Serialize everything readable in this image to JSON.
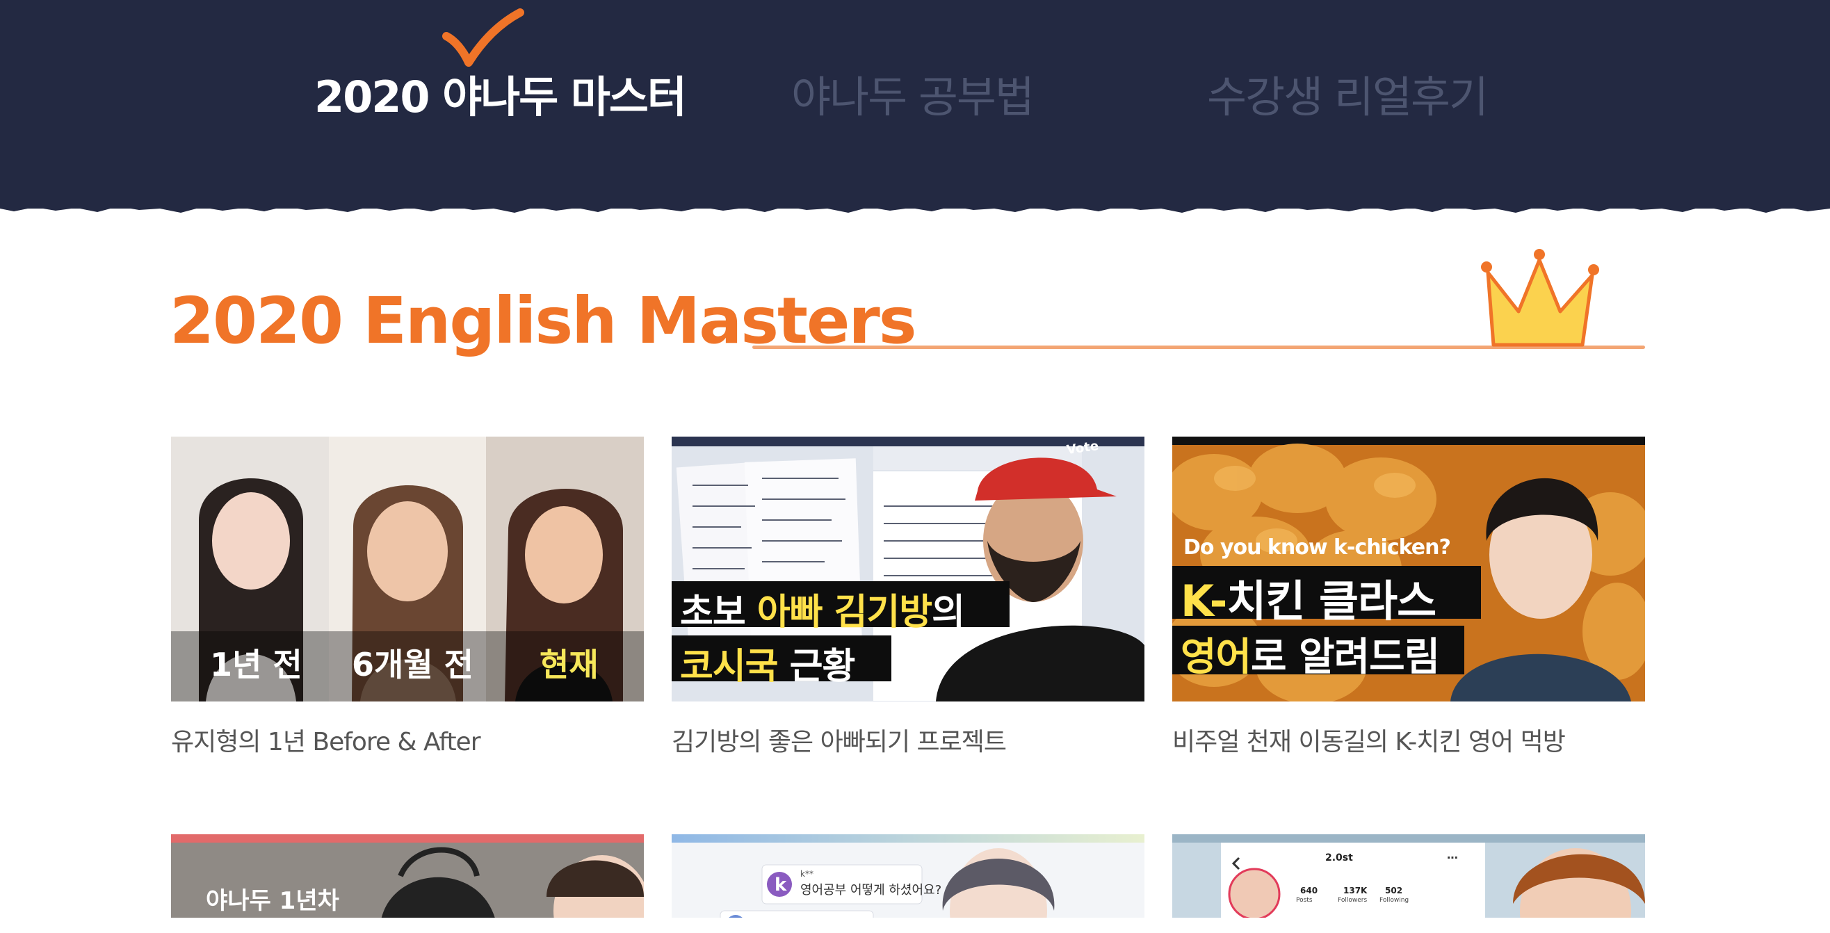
{
  "nav": {
    "items": [
      {
        "label": "2020 야나두 마스터",
        "active": true
      },
      {
        "label": "야나두 공부법",
        "active": false
      },
      {
        "label": "수강생 리얼후기",
        "active": false
      }
    ]
  },
  "section": {
    "title": "2020 English Masters"
  },
  "cards": [
    {
      "title": "유지형의 1년 Before & After",
      "thumb": {
        "captions": [
          "1년 전",
          "6개월 전",
          "현재"
        ]
      }
    },
    {
      "title": "김기방의 좋은 아빠되기 프로젝트",
      "thumb": {
        "line1_white": "초보 ",
        "line1_yellow": "아빠 김기방",
        "line1_white2": "의",
        "line2_yellow": "코시국 ",
        "line2_white": "근황",
        "cap_text": "Vote"
      }
    },
    {
      "title": "비주얼 천재 이동길의 K-치킨 영어 먹방",
      "thumb": {
        "small": "Do you know k-chicken?",
        "line1_yellow": "K-",
        "line1_white": "치킨 클라스",
        "line2_yellow": "영어",
        "line2_white": "로 알려드림"
      }
    }
  ],
  "row2": [
    {
      "caption": "야나두 1년차"
    },
    {
      "chat1_name": "k**",
      "chat1_text": "영어공부 어떻게 하셨어요?"
    },
    {
      "profile": "2.0st",
      "stats": [
        {
          "num": "640",
          "label": "Posts"
        },
        {
          "num": "137K",
          "label": "Followers"
        },
        {
          "num": "502",
          "label": "Following"
        }
      ]
    }
  ],
  "colors": {
    "header_bg": "#232942",
    "accent_orange": "#f07428",
    "caption_yellow": "#ffe14a"
  }
}
